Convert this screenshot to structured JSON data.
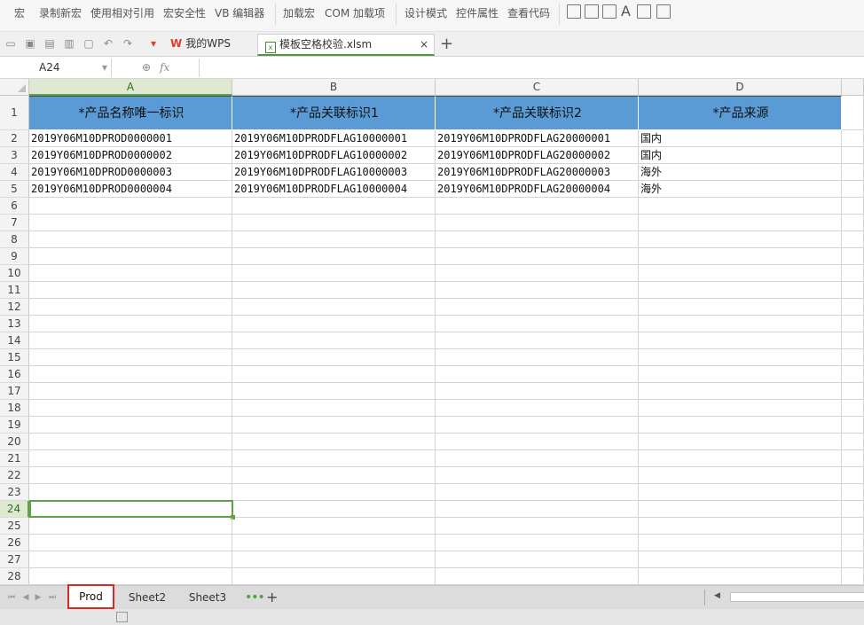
{
  "ribbon": {
    "items": [
      "宏",
      "录制新宏",
      "使用相对引用",
      "宏安全性",
      "VB 编辑器",
      "加载宏",
      "COM 加载项",
      "设计模式",
      "控件属性",
      "查看代码"
    ]
  },
  "tabs": {
    "home_label": "我的WPS",
    "file_label": "模板空格校验.xlsm",
    "close_glyph": "×",
    "new_tab_glyph": "+"
  },
  "formula_bar": {
    "cell_ref": "A24",
    "fx_label": "fx",
    "formula": ""
  },
  "columns": [
    "A",
    "B",
    "C",
    "D"
  ],
  "header_row": [
    "*产品名称唯一标识",
    "*产品关联标识1",
    "*产品关联标识2",
    "*产品来源"
  ],
  "rows": [
    [
      "2019Y06M10DPROD0000001",
      "2019Y06M10DPRODFLAG10000001",
      "2019Y06M10DPRODFLAG20000001",
      "国内"
    ],
    [
      "2019Y06M10DPROD0000002",
      "2019Y06M10DPRODFLAG10000002",
      "2019Y06M10DPRODFLAG20000002",
      "国内"
    ],
    [
      "2019Y06M10DPROD0000003",
      "2019Y06M10DPRODFLAG10000003",
      "2019Y06M10DPRODFLAG20000003",
      "海外"
    ],
    [
      "2019Y06M10DPROD0000004",
      "2019Y06M10DPRODFLAG10000004",
      "2019Y06M10DPRODFLAG20000004",
      "海外"
    ]
  ],
  "row_numbers": [
    "1",
    "2",
    "3",
    "4",
    "5",
    "6",
    "7",
    "8",
    "9",
    "10",
    "11",
    "12",
    "13",
    "14",
    "15",
    "16",
    "17",
    "18",
    "19",
    "20",
    "21",
    "22",
    "23",
    "24",
    "25",
    "26",
    "27",
    "28"
  ],
  "selected_cell": {
    "column": "A",
    "row": 24
  },
  "sheets": {
    "tabs": [
      "Prod",
      "Sheet2",
      "Sheet3"
    ],
    "active": "Prod",
    "more_glyph": "•••",
    "add_glyph": "+"
  },
  "colors": {
    "header_fill": "#5b9bd5",
    "selection": "#5fa14a",
    "active_tab_outline": "#e0261f"
  }
}
